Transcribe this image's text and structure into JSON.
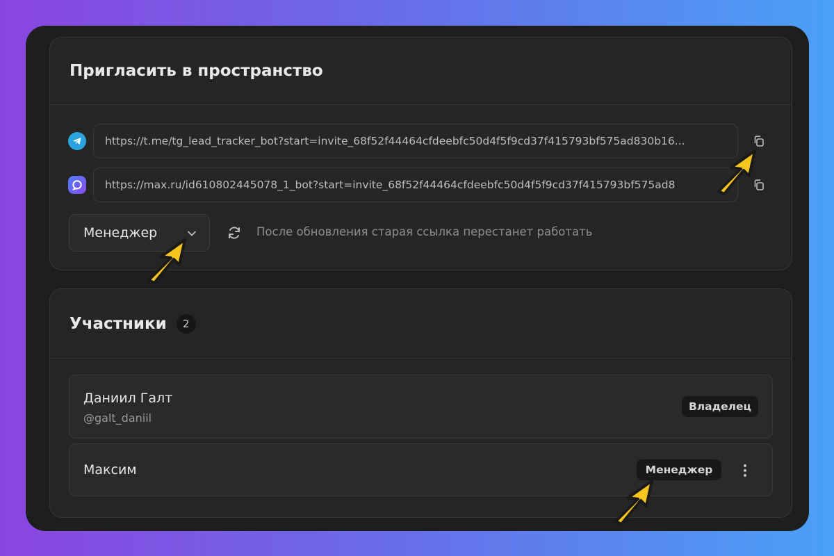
{
  "invite": {
    "title": "Пригласить в пространство",
    "telegram_link": "https://t.me/tg_lead_tracker_bot?start=invite_68f52f44464cfdeebfc50d4f5f9cd37f415793bf575ad830b16...",
    "max_link": "https://max.ru/id610802445078_1_bot?start=invite_68f52f44464cfdeebfc50d4f5f9cd37f415793bf575ad8",
    "role_selected": "Менеджер",
    "refresh_note": "После обновления старая ссылка перестанет работать",
    "icons": {
      "telegram": "telegram-icon",
      "max": "max-messenger-icon",
      "copy": "copy-icon",
      "chevron": "chevron-down-icon",
      "refresh": "refresh-icon"
    }
  },
  "members": {
    "title": "Участники",
    "count": "2",
    "list": [
      {
        "name": "Даниил Галт",
        "handle": "@galt_daniil",
        "role": "Владелец"
      },
      {
        "name": "Максим",
        "role": "Менеджер"
      }
    ]
  },
  "colors": {
    "background_gradient": [
      "#8b45e0",
      "#4aa0f8"
    ],
    "panel": "#1e1e1e",
    "card": "#252525",
    "arrow": "#f7c51e",
    "telegram": "#2aa3de"
  }
}
